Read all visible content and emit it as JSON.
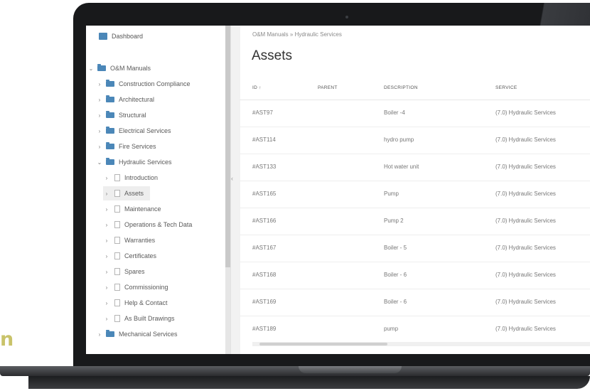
{
  "accent_text": "n",
  "sidebar": {
    "dashboard": "Dashboard",
    "root": "O&M Manuals",
    "folders": [
      "Construction Compliance",
      "Architectural",
      "Structural",
      "Electrical Services",
      "Fire Services",
      "Hydraulic Services"
    ],
    "pages": [
      "Introduction",
      "Assets",
      "Maintenance",
      "Operations & Tech Data",
      "Warranties",
      "Certificates",
      "Spares",
      "Commissioning",
      "Help & Contact",
      "As Built Drawings"
    ],
    "after_folders": [
      "Mechanical Services"
    ]
  },
  "breadcrumb": "O&M Manuals » Hydraulic Services",
  "page_title": "Assets",
  "table": {
    "columns": [
      "ID ↑",
      "PARENT",
      "DESCRIPTION",
      "SERVICE"
    ],
    "rows": [
      {
        "id": "#AST97",
        "parent": "",
        "description": "Boiler -4",
        "service": "(7.0) Hydraulic Services"
      },
      {
        "id": "#AST114",
        "parent": "",
        "description": "hydro pump",
        "service": "(7.0) Hydraulic Services"
      },
      {
        "id": "#AST133",
        "parent": "",
        "description": "Hot water unit",
        "service": "(7.0) Hydraulic Services"
      },
      {
        "id": "#AST165",
        "parent": "",
        "description": "Pump",
        "service": "(7.0) Hydraulic Services"
      },
      {
        "id": "#AST166",
        "parent": "",
        "description": "Pump 2",
        "service": "(7.0) Hydraulic Services"
      },
      {
        "id": "#AST167",
        "parent": "",
        "description": "Boiler - 5",
        "service": "(7.0) Hydraulic Services"
      },
      {
        "id": "#AST168",
        "parent": "",
        "description": "Boiler - 6",
        "service": "(7.0) Hydraulic Services"
      },
      {
        "id": "#AST169",
        "parent": "",
        "description": "Boiler - 6",
        "service": "(7.0) Hydraulic Services"
      },
      {
        "id": "#AST189",
        "parent": "",
        "description": "pump",
        "service": "(7.0) Hydraulic Services"
      }
    ]
  },
  "colors": {
    "folder": "#4b87b8",
    "accent": "#c9c36a"
  }
}
